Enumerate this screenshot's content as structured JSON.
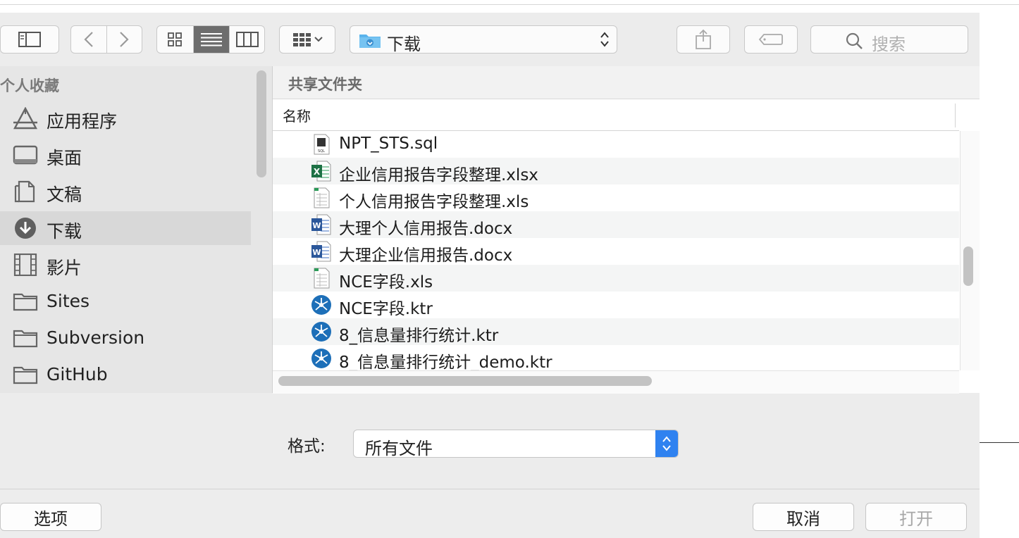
{
  "toolbar": {
    "sidebar_toggle_icon": "sidebar-icon",
    "back_icon": "chevron-left-icon",
    "forward_icon": "chevron-right-icon",
    "view_modes": [
      "icon-grid-icon",
      "list-view-icon",
      "column-view-icon"
    ],
    "active_view": "list-view-icon",
    "group_icon": "group-by-icon",
    "location": "下载",
    "share_icon": "share-icon",
    "tag_icon": "tag-icon",
    "search_placeholder": "搜索"
  },
  "sidebar": {
    "heading": "个人收藏",
    "items": [
      {
        "label": "应用程序",
        "icon": "applications-icon"
      },
      {
        "label": "桌面",
        "icon": "desktop-icon"
      },
      {
        "label": "文稿",
        "icon": "documents-icon"
      },
      {
        "label": "下载",
        "icon": "downloads-icon",
        "selected": true
      },
      {
        "label": "影片",
        "icon": "movies-icon"
      },
      {
        "label": "Sites",
        "icon": "folder-icon"
      },
      {
        "label": "Subversion",
        "icon": "folder-icon"
      },
      {
        "label": "GitHub",
        "icon": "folder-icon"
      }
    ]
  },
  "pane": {
    "title": "共享文件夹",
    "column_name": "名称",
    "files": [
      {
        "name": "NPT_STS.sql",
        "icon": "sql-file-icon"
      },
      {
        "name": "企业信用报告字段整理.xlsx",
        "icon": "excel-file-icon"
      },
      {
        "name": "个人信用报告字段整理.xls",
        "icon": "spreadsheet-file-icon"
      },
      {
        "name": "大理个人信用报告.docx",
        "icon": "word-file-icon"
      },
      {
        "name": "大理企业信用报告.docx",
        "icon": "word-file-icon"
      },
      {
        "name": "NCE字段.xls",
        "icon": "spreadsheet-file-icon"
      },
      {
        "name": "NCE字段.ktr",
        "icon": "kettle-file-icon"
      },
      {
        "name": "8_信息量排行统计.ktr",
        "icon": "kettle-file-icon"
      },
      {
        "name": "8_信息量排行统计_demo.ktr",
        "icon": "kettle-file-icon"
      }
    ]
  },
  "format": {
    "label": "格式:",
    "value": "所有文件"
  },
  "buttons": {
    "options": "选项",
    "cancel": "取消",
    "open": "打开"
  },
  "colors": {
    "accent": "#2f82f0",
    "selected_row": "#d8d8d8"
  }
}
